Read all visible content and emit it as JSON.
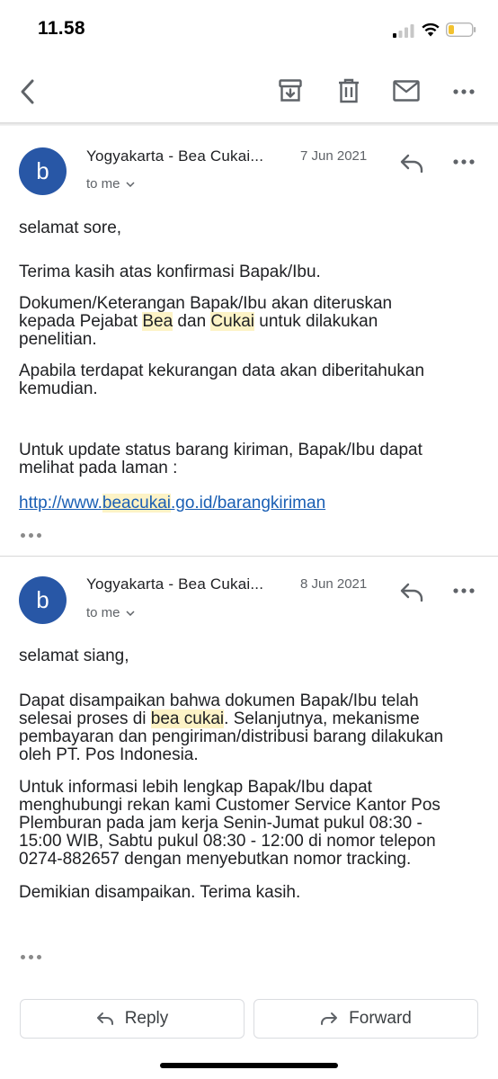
{
  "status_bar": {
    "time": "11.58"
  },
  "toolbar": {
    "back_icon": "chevron-left-icon",
    "archive_icon": "archive-icon",
    "delete_icon": "trash-icon",
    "mark_unread_icon": "mail-icon",
    "more_icon": "more-horizontal-icon"
  },
  "messages": [
    {
      "avatar_letter": "b",
      "sender": "Yogyakarta - Bea Cukai...",
      "date": "7 Jun 2021",
      "recipient": "to me",
      "greeting": "selamat sore,",
      "p1": "Terima kasih atas konfirmasi Bapak/Ibu.",
      "p2_line1": "Dokumen/Keterangan Bapak/Ibu akan diteruskan",
      "p2_line2_pre": "kepada Pejabat ",
      "p2_hl1": "Bea",
      "p2_line2_mid": " dan ",
      "p2_hl2": "Cukai",
      "p2_line2_post": " untuk dilakukan",
      "p2_line3": "penelitian.",
      "p3_line1": "Apabila terdapat kekurangan data akan diberitahukan",
      "p3_line2": "kemudian.",
      "p4_line1": "Untuk update status barang kiriman, Bapak/Ibu dapat",
      "p4_line2": "melihat pada laman :",
      "link_pre": "http://www.",
      "link_hl": "beacukai",
      "link_post": ".go.id/barangkiriman"
    },
    {
      "avatar_letter": "b",
      "sender": "Yogyakarta - Bea Cukai...",
      "date": "8 Jun 2021",
      "recipient": "to me",
      "greeting": "selamat siang,",
      "p1_line1": "Dapat disampaikan bahwa dokumen Bapak/Ibu telah",
      "p1_line2_pre": "selesai proses di ",
      "p1_hl": "bea cukai",
      "p1_line2_post": ". Selanjutnya, mekanisme",
      "p1_line3": "pembayaran dan pengiriman/distribusi barang dilakukan",
      "p1_line4": "oleh PT. Pos Indonesia.",
      "p2_line1": "Untuk informasi lebih lengkap Bapak/Ibu dapat",
      "p2_line2": "menghubungi rekan kami Customer Service Kantor Pos",
      "p2_line3": "Plemburan pada jam kerja Senin-Jumat pukul 08:30 -",
      "p2_line4": "15:00 WIB, Sabtu pukul 08:30 - 12:00 di nomor telepon",
      "p2_line5": "0274-882657 dengan menyebutkan nomor tracking.",
      "p3": "Demikian disampaikan. Terima kasih."
    }
  ],
  "actions": {
    "reply_label": "Reply",
    "forward_label": "Forward"
  },
  "colors": {
    "avatar": "#2857a6",
    "link": "#1a5fb4",
    "highlight": "#fdf3c6"
  }
}
